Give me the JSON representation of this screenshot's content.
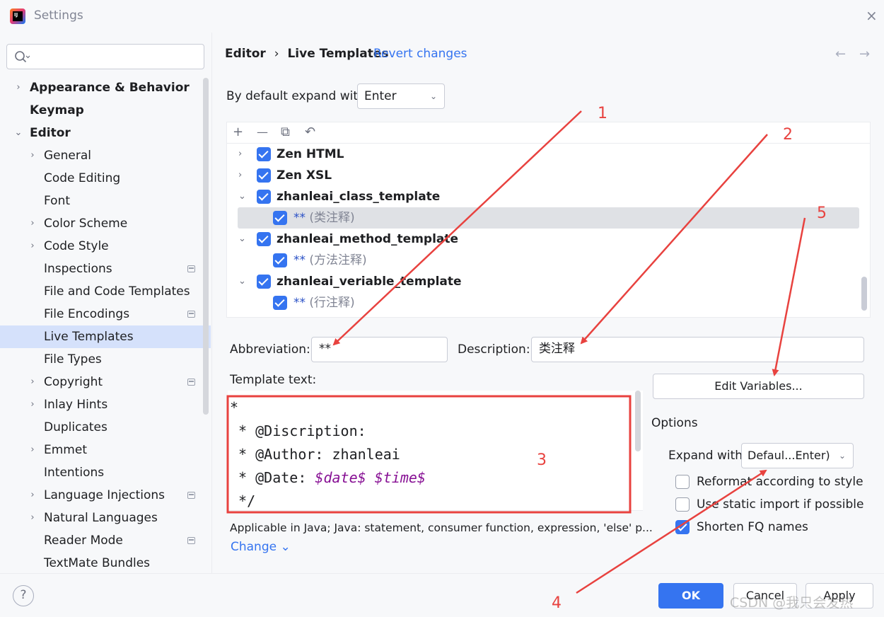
{
  "window": {
    "title": "Settings",
    "close": "×"
  },
  "sidebar": {
    "search_placeholder": "",
    "items": [
      {
        "label": "Appearance & Behavior",
        "level": 0,
        "bold": true,
        "chevron": "›"
      },
      {
        "label": "Keymap",
        "level": 0,
        "bold": true,
        "chevron": ""
      },
      {
        "label": "Editor",
        "level": 0,
        "bold": true,
        "chevron": "⌄"
      },
      {
        "label": "General",
        "level": 1,
        "chevron": "›"
      },
      {
        "label": "Code Editing",
        "level": 1,
        "chevron": ""
      },
      {
        "label": "Font",
        "level": 1,
        "chevron": ""
      },
      {
        "label": "Color Scheme",
        "level": 1,
        "chevron": "›"
      },
      {
        "label": "Code Style",
        "level": 1,
        "chevron": "›"
      },
      {
        "label": "Inspections",
        "level": 1,
        "chevron": "",
        "marker": true
      },
      {
        "label": "File and Code Templates",
        "level": 1,
        "chevron": ""
      },
      {
        "label": "File Encodings",
        "level": 1,
        "chevron": "",
        "marker": true
      },
      {
        "label": "Live Templates",
        "level": 1,
        "chevron": "",
        "selected": true
      },
      {
        "label": "File Types",
        "level": 1,
        "chevron": ""
      },
      {
        "label": "Copyright",
        "level": 1,
        "chevron": "›",
        "marker": true
      },
      {
        "label": "Inlay Hints",
        "level": 1,
        "chevron": "›"
      },
      {
        "label": "Duplicates",
        "level": 1,
        "chevron": ""
      },
      {
        "label": "Emmet",
        "level": 1,
        "chevron": "›"
      },
      {
        "label": "Intentions",
        "level": 1,
        "chevron": ""
      },
      {
        "label": "Language Injections",
        "level": 1,
        "chevron": "›",
        "marker": true
      },
      {
        "label": "Natural Languages",
        "level": 1,
        "chevron": "›"
      },
      {
        "label": "Reader Mode",
        "level": 1,
        "chevron": "",
        "marker": true
      },
      {
        "label": "TextMate Bundles",
        "level": 1,
        "chevron": ""
      }
    ]
  },
  "header": {
    "crumb_parent": "Editor",
    "crumb_sep": "›",
    "crumb_current": "Live Templates",
    "revert": "Revert changes",
    "back": "←",
    "forward": "→"
  },
  "expand": {
    "label": "By default expand with",
    "value": "Enter"
  },
  "toolbar": {
    "add": "+",
    "remove": "—",
    "copy": "⧉",
    "restore": "↶"
  },
  "templates": [
    {
      "type": "group",
      "chevron": "›",
      "name": "Zen HTML"
    },
    {
      "type": "group",
      "chevron": "›",
      "name": "Zen XSL"
    },
    {
      "type": "group",
      "chevron": "⌄",
      "name": "zhanleai_class_template"
    },
    {
      "type": "item",
      "key": "**",
      "desc": "(类注释)",
      "highlight": true
    },
    {
      "type": "group",
      "chevron": "⌄",
      "name": "zhanleai_method_template"
    },
    {
      "type": "item",
      "key": "**",
      "desc": "(方法注释)"
    },
    {
      "type": "group",
      "chevron": "⌄",
      "name": "zhanleai_veriable_template"
    },
    {
      "type": "item",
      "key": "**",
      "desc": "(行注释)"
    }
  ],
  "form": {
    "abbr_label": "Abbreviation:",
    "abbr_value": "**",
    "desc_label": "Description:",
    "desc_value": "类注释",
    "tmpl_label": "Template text:",
    "lines": [
      {
        "text": "*"
      },
      {
        "text": " * @Discription:"
      },
      {
        "text": " * @Author: zhanleai"
      },
      {
        "text": " * @Date: ",
        "var1": "$date$",
        "sp": " ",
        "var2": "$time$"
      },
      {
        "text": " */"
      }
    ],
    "applicable": "Applicable in Java; Java: statement, consumer function, expression, 'else' p...",
    "change": "Change ⌄"
  },
  "options": {
    "edit_vars": "Edit Variables...",
    "title": "Options",
    "expand_label": "Expand with",
    "expand_value": "Defaul...Enter)",
    "reformat": "Reformat according to style",
    "static_import": "Use static import if possible",
    "shorten": "Shorten FQ names"
  },
  "footer": {
    "help": "?",
    "ok": "OK",
    "cancel": "Cancel",
    "apply": "Apply",
    "watermark": "CSDN @我只会发热"
  },
  "annotations": {
    "n1": "1",
    "n2": "2",
    "n3": "3",
    "n4": "4",
    "n5": "5",
    "color": "#e8423f"
  }
}
